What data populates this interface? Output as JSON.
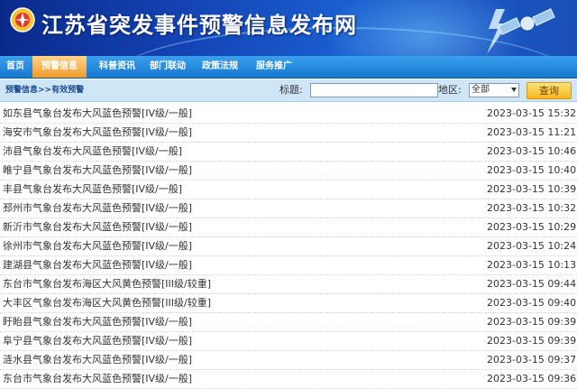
{
  "header": {
    "title": "江苏省突发事件预警信息发布网"
  },
  "nav": {
    "items": [
      {
        "label": "首页"
      },
      {
        "label": "预警信息"
      },
      {
        "label": "科普资讯"
      },
      {
        "label": "部门联动"
      },
      {
        "label": "政策法规"
      },
      {
        "label": "服务推广"
      }
    ],
    "active_index": 1
  },
  "searchbar": {
    "breadcrumb": "预警信息>>有效预警",
    "title_label": "标题:",
    "title_value": "",
    "region_label": "地区:",
    "region_selected": "全部",
    "query_button": "查询"
  },
  "warnings": [
    {
      "title": "如东县气象台发布大风蓝色预警[IV级/一般]",
      "time": "2023-03-15 15:32"
    },
    {
      "title": "海安市气象台发布大风蓝色预警[IV级/一般]",
      "time": "2023-03-15 11:21"
    },
    {
      "title": "沛县气象台发布大风蓝色预警[IV级/一般]",
      "time": "2023-03-15 10:46"
    },
    {
      "title": "睢宁县气象台发布大风蓝色预警[IV级/一般]",
      "time": "2023-03-15 10:40"
    },
    {
      "title": "丰县气象台发布大风蓝色预警[IV级/一般]",
      "time": "2023-03-15 10:39"
    },
    {
      "title": "邳州市气象台发布大风蓝色预警[IV级/一般]",
      "time": "2023-03-15 10:32"
    },
    {
      "title": "新沂市气象台发布大风蓝色预警[IV级/一般]",
      "time": "2023-03-15 10:29"
    },
    {
      "title": "徐州市气象台发布大风蓝色预警[IV级/一般]",
      "time": "2023-03-15 10:24"
    },
    {
      "title": "建湖县气象台发布大风蓝色预警[IV级/一般]",
      "time": "2023-03-15 10:13"
    },
    {
      "title": "东台市气象台发布海区大风黄色预警[III级/较重]",
      "time": "2023-03-15 09:44"
    },
    {
      "title": "大丰区气象台发布海区大风黄色预警[III级/较重]",
      "time": "2023-03-15 09:40"
    },
    {
      "title": "盱眙县气象台发布大风蓝色预警[IV级/一般]",
      "time": "2023-03-15 09:39"
    },
    {
      "title": "阜宁县气象台发布大风蓝色预警[IV级/一般]",
      "time": "2023-03-15 09:39"
    },
    {
      "title": "涟水县气象台发布大风蓝色预警[IV级/一般]",
      "time": "2023-03-15 09:37"
    },
    {
      "title": "东台市气象台发布大风蓝色预警[IV级/一般]",
      "time": "2023-03-15 09:36"
    }
  ],
  "colors": {
    "banner": "#1546b8",
    "nav": "#1877cf",
    "nav_active": "#f29a2a",
    "bar": "#cfe6f7",
    "query_button": "#f3b820"
  }
}
